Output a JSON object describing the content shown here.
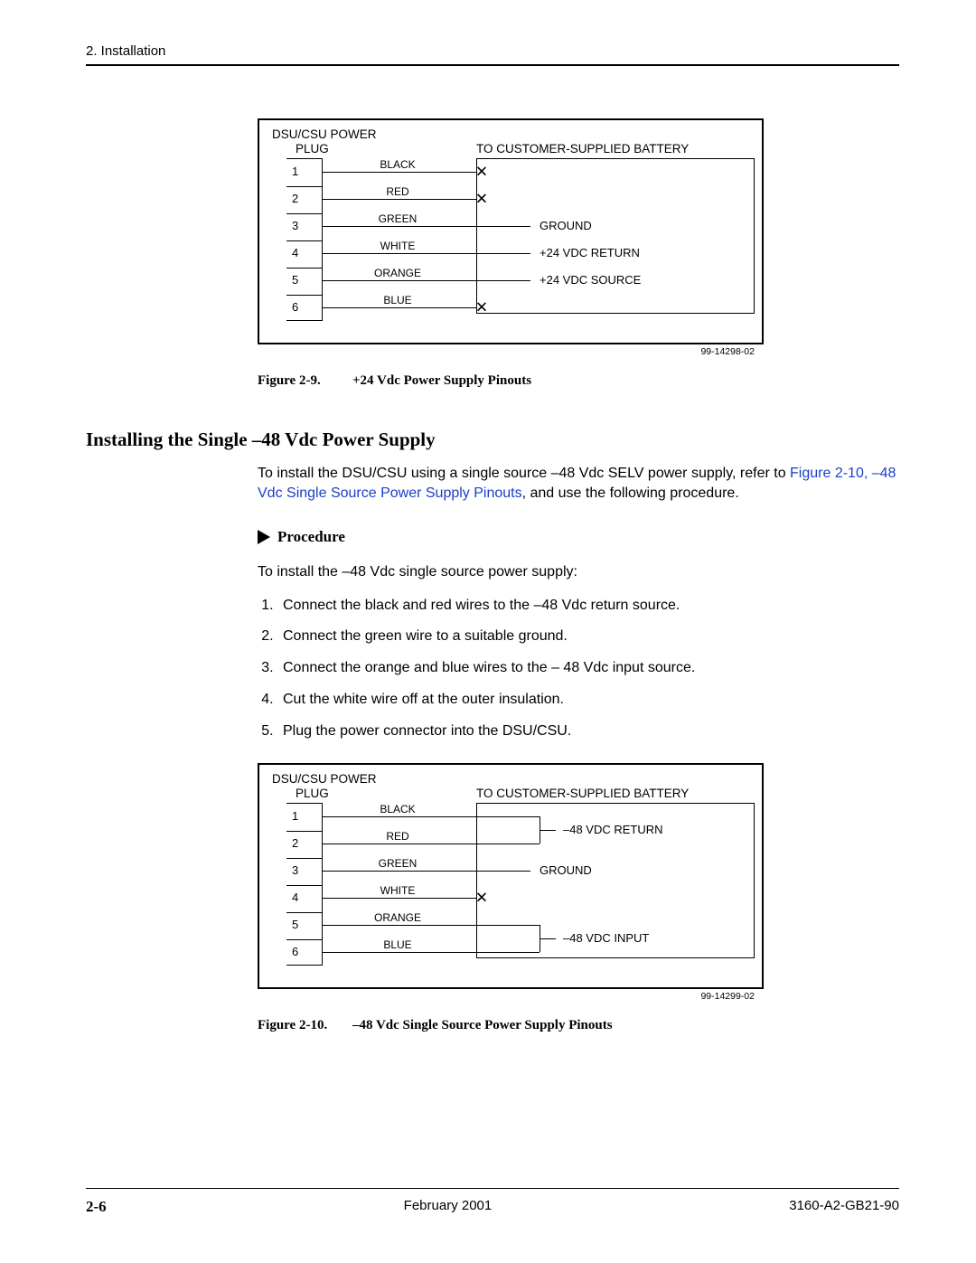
{
  "header": {
    "section": "2. Installation"
  },
  "figure9": {
    "caption_num": "Figure 2-9.",
    "caption_title": "+24 Vdc Power Supply Pinouts",
    "plug_title1": "DSU/CSU POWER",
    "plug_title2": "PLUG",
    "batt_title": "TO CUSTOMER-SUPPLIED BATTERY",
    "pins": [
      "1",
      "2",
      "3",
      "4",
      "5",
      "6"
    ],
    "wires": [
      "BLACK",
      "RED",
      "GREEN",
      "WHITE",
      "ORANGE",
      "BLUE"
    ],
    "dests": {
      "ground": "GROUND",
      "ret": "+24 VDC RETURN",
      "src": "+24 VDC SOURCE"
    },
    "dnum": "99-14298-02"
  },
  "section": {
    "title": "Installing the Single –48 Vdc Power Supply",
    "intro_pre": "To install the DSU/CSU using a single source –48 Vdc SELV power supply, refer to ",
    "intro_link": "Figure 2-10, –48 Vdc Single Source Power Supply Pinouts",
    "intro_post": ", and use the following procedure."
  },
  "procedure": {
    "heading": "Procedure",
    "intro": "To install the –48 Vdc single source power supply:",
    "steps": [
      "Connect the black and red wires to the –48 Vdc return source.",
      "Connect the green wire to a suitable ground.",
      "Connect the orange and blue wires to the – 48 Vdc input source.",
      "Cut the white wire off at the outer insulation.",
      "Plug the power connector into the DSU/CSU."
    ]
  },
  "figure10": {
    "caption_num": "Figure 2-10.",
    "caption_title": "–48 Vdc Single Source Power Supply Pinouts",
    "plug_title1": "DSU/CSU POWER",
    "plug_title2": "PLUG",
    "batt_title": "TO CUSTOMER-SUPPLIED BATTERY",
    "pins": [
      "1",
      "2",
      "3",
      "4",
      "5",
      "6"
    ],
    "wires": [
      "BLACK",
      "RED",
      "GREEN",
      "WHITE",
      "ORANGE",
      "BLUE"
    ],
    "dests": {
      "ret": "–48 VDC RETURN",
      "ground": "GROUND",
      "inp": "–48 VDC INPUT"
    },
    "dnum": "99-14299-02"
  },
  "footer": {
    "page": "2-6",
    "date": "February 2001",
    "doc": "3160-A2-GB21-90"
  }
}
